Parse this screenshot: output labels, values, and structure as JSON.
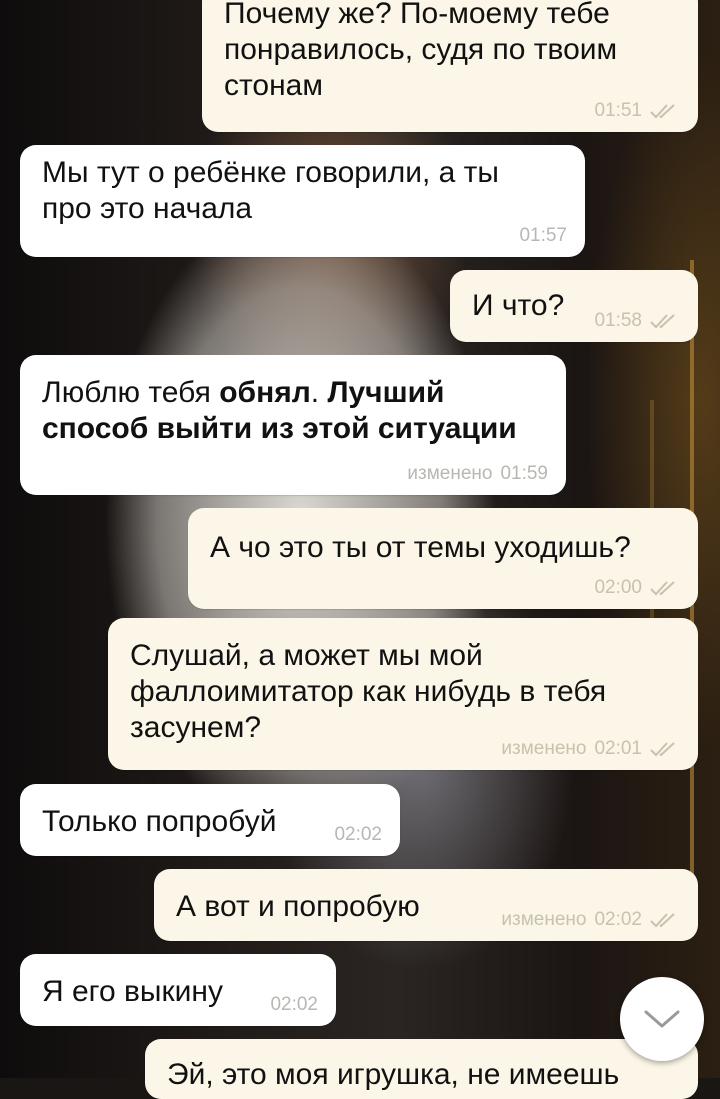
{
  "messages": [
    {
      "id": "m1",
      "dir": "out",
      "text": "Почему же? По-моему тебе\nпонравилось, судя по твоим\nстонам",
      "time": "01:51",
      "read": true
    },
    {
      "id": "m2",
      "dir": "in",
      "text": "Мы тут о ребёнке говорили, а ты\nпро это начала",
      "time": "01:57"
    },
    {
      "id": "m3",
      "dir": "out",
      "text": "И что?",
      "time": "01:58",
      "read": true
    },
    {
      "id": "m4",
      "dir": "in",
      "text_parts": [
        "Люблю тебя ",
        "обнял",
        ". ",
        "Лучший\nспособ выйти из этой ситуации"
      ],
      "edited": "изменено",
      "time": "01:59"
    },
    {
      "id": "m5",
      "dir": "out",
      "text": "А чо это ты от темы уходишь?",
      "time": "02:00",
      "read": true
    },
    {
      "id": "m6",
      "dir": "out",
      "text": "Слушай, а может мы мой\nфаллоимитатор как нибудь в тебя\nзасунем?",
      "edited": "изменено",
      "time": "02:01",
      "read": true
    },
    {
      "id": "m7",
      "dir": "in",
      "text": "Только попробуй",
      "time": "02:02"
    },
    {
      "id": "m8",
      "dir": "out",
      "text": "А вот и попробую",
      "edited": "изменено",
      "time": "02:02",
      "read": true
    },
    {
      "id": "m9",
      "dir": "in",
      "text": "Я его выкину",
      "time": "02:02"
    },
    {
      "id": "m10",
      "dir": "out",
      "text": "Эй, это моя игрушка, не имеешь",
      "time": "",
      "read": false
    }
  ],
  "icons": {
    "read_receipt": "double-check-icon",
    "scroll_down": "chevron-down-icon"
  },
  "colors": {
    "incoming_bubble": "#ffffff",
    "outgoing_bubble": "#fbf6e7",
    "ticks": "#c7c2ad",
    "meta_text": "#b9b7b2"
  }
}
